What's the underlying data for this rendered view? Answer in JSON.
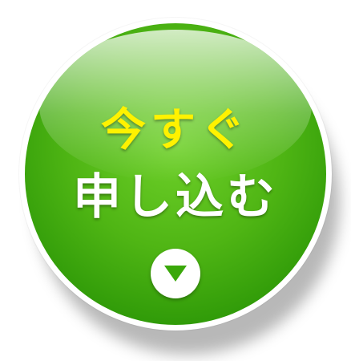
{
  "button": {
    "line1": "今すぐ",
    "line2": "申し込む",
    "icon": "chevron-down-triangle-icon"
  },
  "colors": {
    "green": "#4fb514",
    "yellow_text": "#fff200",
    "white_text": "#ffffff"
  }
}
